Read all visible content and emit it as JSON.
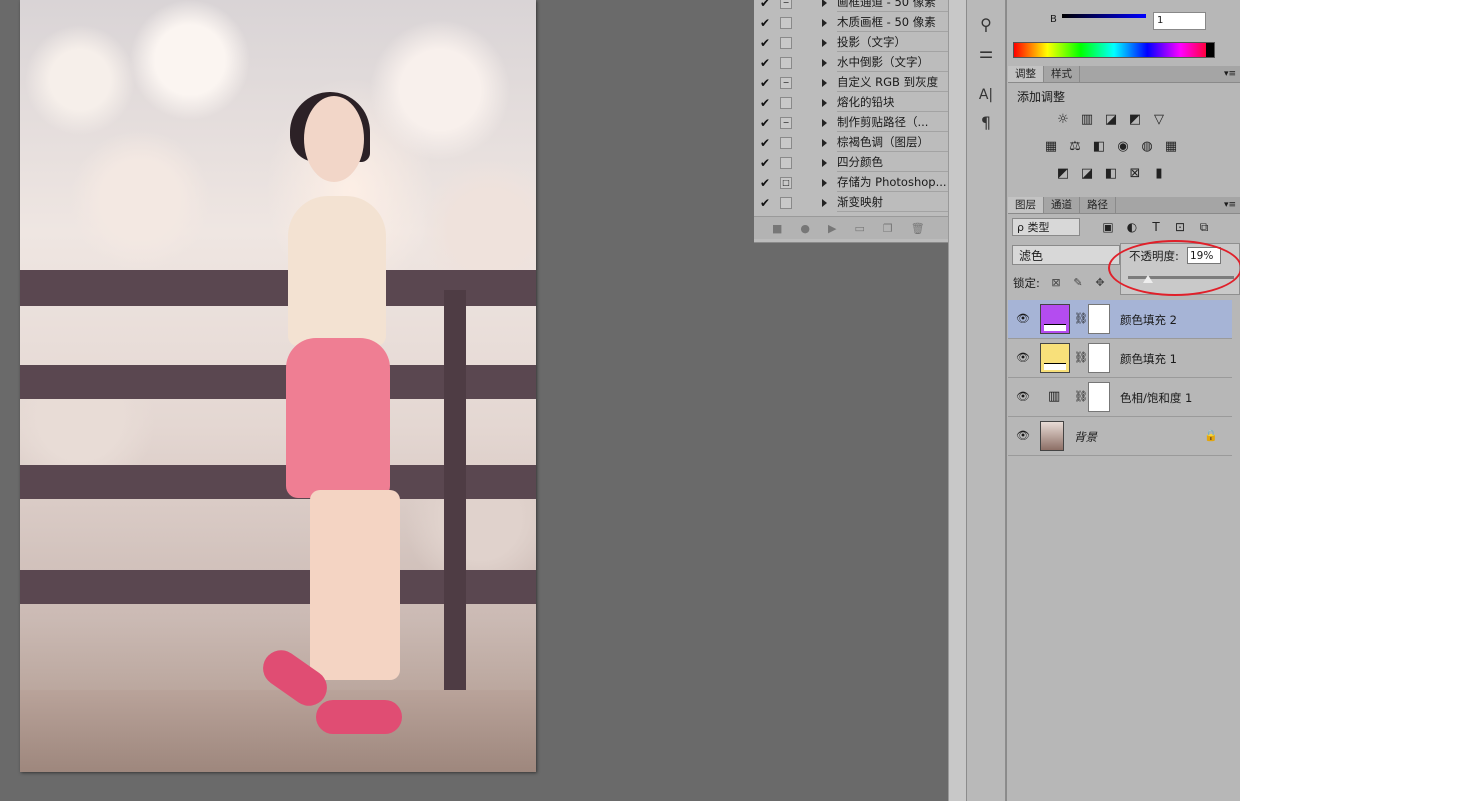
{
  "actions_panel": {
    "items": [
      {
        "check": "✔",
        "toggle": "−",
        "label": "画框通道 - 50 像素"
      },
      {
        "check": "✔",
        "toggle": "",
        "label": "木质画框 - 50 像素"
      },
      {
        "check": "✔",
        "toggle": "",
        "label": "投影（文字）"
      },
      {
        "check": "✔",
        "toggle": "",
        "label": "水中倒影（文字）"
      },
      {
        "check": "✔",
        "toggle": "−",
        "label": "自定义 RGB 到灰度"
      },
      {
        "check": "✔",
        "toggle": "",
        "label": "熔化的铅块"
      },
      {
        "check": "✔",
        "toggle": "−",
        "label": "制作剪贴路径（..."
      },
      {
        "check": "✔",
        "toggle": "",
        "label": "棕褐色调（图层）"
      },
      {
        "check": "✔",
        "toggle": "",
        "label": "四分颜色"
      },
      {
        "check": "✔",
        "toggle": "□",
        "label": "存储为 Photoshop..."
      },
      {
        "check": "✔",
        "toggle": "",
        "label": "渐变映射"
      }
    ],
    "bottom_buttons": [
      "■",
      "●",
      "▶",
      "▭",
      "❐",
      "🗑"
    ]
  },
  "color_panel": {
    "b_label": "B",
    "b_value": "1"
  },
  "adjust_panel": {
    "tabs": [
      "调整",
      "样式"
    ],
    "title": "添加调整",
    "row1": [
      "☼",
      "▥",
      "◪",
      "◩",
      "▽"
    ],
    "row2": [
      "▦",
      "⚖",
      "◧",
      "◉",
      "◍",
      "▦"
    ],
    "row3": [
      "◩",
      "◪",
      "◧",
      "⊠",
      "▮"
    ]
  },
  "layers_panel": {
    "tabs": [
      "图层",
      "通道",
      "路径"
    ],
    "filter_label": "ρ 类型",
    "filter_icons": [
      "▣",
      "◐",
      "T",
      "⊡",
      "⧉"
    ],
    "blend_mode": "滤色",
    "opacity_label": "不透明度:",
    "opacity_value": "19%",
    "opacity_level": 0.19,
    "lock_label": "锁定:",
    "lock_icons": [
      "⊠",
      "✎",
      "✥"
    ],
    "layers": [
      {
        "name": "颜色填充 2",
        "thumb_color": "#b44cf0",
        "selected": true
      },
      {
        "name": "颜色填充 1",
        "thumb_color": "#f8e07a",
        "selected": false
      },
      {
        "name": "色相/饱和度 1",
        "thumb_color": "",
        "selected": false
      },
      {
        "name": "背景",
        "thumb_color": "",
        "selected": false
      }
    ]
  },
  "dock_icons": [
    "⚲",
    "⚌",
    "A|",
    "¶"
  ],
  "colors": {
    "workspace": "#6a6a6a",
    "panel": "#b7b7b7",
    "selected_layer": "#a6b4d6",
    "highlight_circle": "#e0202a"
  }
}
